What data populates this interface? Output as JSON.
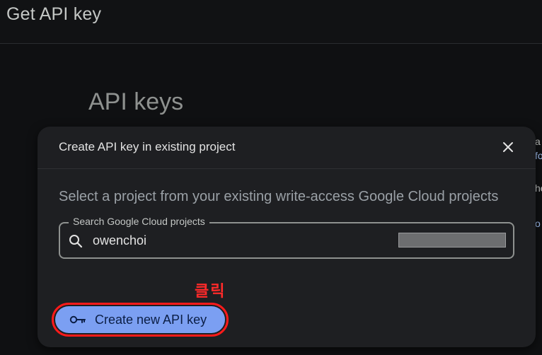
{
  "header": {
    "title": "Get API key"
  },
  "main": {
    "section_title": "API keys",
    "right_fragments": [
      "a",
      "fo",
      "he",
      "o"
    ]
  },
  "dialog": {
    "title": "Create API key in existing project",
    "subtitle": "Select a project from your existing write-access Google Cloud projects",
    "search": {
      "label": "Search Google Cloud projects",
      "value": "owenchoi"
    },
    "annotation": "클릭",
    "create_button_label": "Create new API key",
    "icons": {
      "close": "close-icon",
      "search": "search-icon",
      "key": "key-icon"
    }
  },
  "colors": {
    "accent_button": "#7b9ff2",
    "highlight_border": "#ff1a1a",
    "annotation_text": "#ff2a2a"
  }
}
